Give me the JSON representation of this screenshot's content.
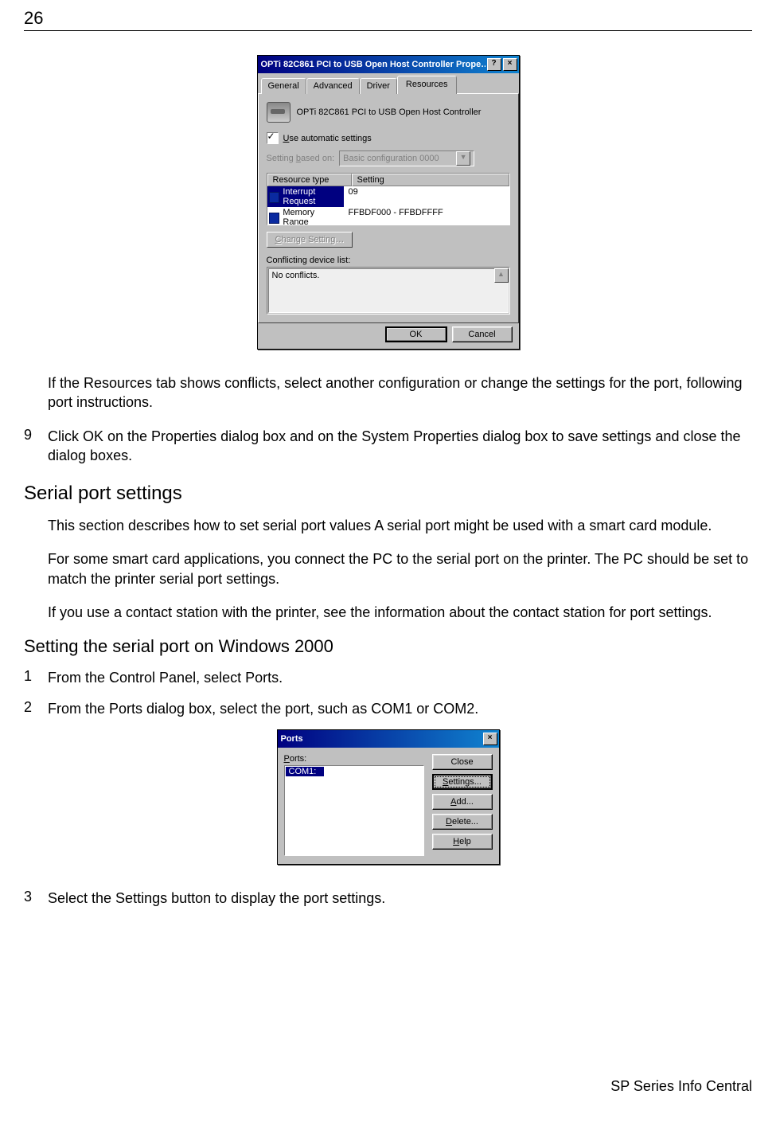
{
  "page": {
    "number": "26",
    "footer": "SP Series Info Central"
  },
  "dialog1": {
    "title": "OPTi 82C861 PCI to USB Open Host Controller Prope…",
    "help_btn": "?",
    "close_btn": "×",
    "tabs": {
      "general": "General",
      "advanced": "Advanced",
      "driver": "Driver",
      "resources": "Resources"
    },
    "device_name": "OPTi 82C861 PCI to USB Open Host Controller",
    "use_auto_label": "Use automatic settings",
    "setting_based_label": "Setting based on:",
    "setting_based_value": "Basic configuration 0000",
    "col_type": "Resource type",
    "col_setting": "Setting",
    "rows": [
      {
        "type": "Interrupt Request",
        "setting": "09"
      },
      {
        "type": "Memory Range",
        "setting": "FFBDF000 - FFBDFFFF"
      }
    ],
    "change_btn": "Change Setting…",
    "conflict_label": "Conflicting device list:",
    "conflict_text": "No conflicts.",
    "ok": "OK",
    "cancel": "Cancel"
  },
  "text": {
    "after_dlg1": "If the Resources tab shows conflicts, select another configuration or change the settings for the port, following port instructions.",
    "step9": "Click OK on the Properties dialog box and on the System Properties dialog box to save settings and close the dialog boxes.",
    "h_serial": "Serial port settings",
    "serial_p1": "This section describes how to set serial port values A serial port might be used with a smart card module.",
    "serial_p2": "For some smart card applications, you connect the PC to the serial port on the printer. The PC should be set to match the printer serial port settings.",
    "serial_p3": "If you use a contact station with the printer, see the information about the contact station for port settings.",
    "h_win2000": "Setting the serial port on Windows 2000",
    "step1": "From the Control Panel, select Ports.",
    "step2": "From the Ports dialog box, select the port, such as COM1 or COM2.",
    "step3": "Select the Settings button to display the port settings."
  },
  "dialog2": {
    "title": "Ports",
    "close_btn": "×",
    "ports_label": "Ports:",
    "selected_port": "COM1:",
    "buttons": {
      "close": "Close",
      "settings": "Settings...",
      "add": "Add...",
      "delete": "Delete...",
      "help": "Help"
    }
  }
}
